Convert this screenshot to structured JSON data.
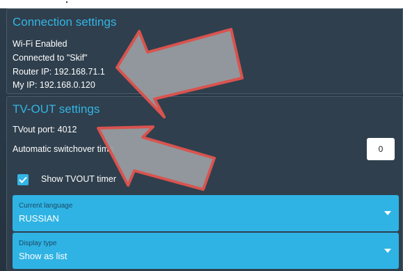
{
  "connection": {
    "title": "Connection settings",
    "wifi_status": "Wi-Fi Enabled",
    "connected_to": "Connected to \"Skif\"",
    "router_ip": "Router IP: 192.168.71.1",
    "my_ip": "My IP: 192.168.0.120"
  },
  "tvout": {
    "title": "TV-OUT settings",
    "port": "TVout port: 4012",
    "switchover_label": "Automatic switchover time",
    "switchover_value": "0",
    "show_timer_label": "Show TVOUT timer",
    "show_timer_checked": true
  },
  "language": {
    "label": "Current language",
    "value": "RUSSIAN"
  },
  "display_type": {
    "label": "Display type",
    "value": "Show as list"
  },
  "colors": {
    "accent": "#33b5e5",
    "background": "#2b3a48",
    "annotation_arrow_fill": "#9a9ea3",
    "annotation_arrow_outline": "#d9534f"
  }
}
